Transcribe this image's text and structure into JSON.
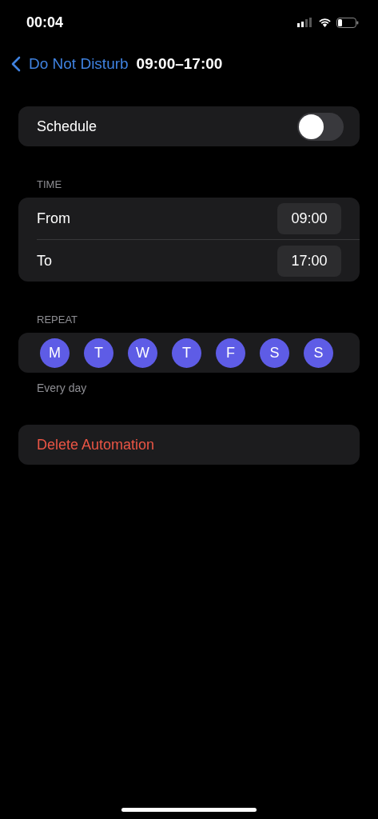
{
  "status_bar": {
    "time": "00:04"
  },
  "nav": {
    "back_label": "Do Not Disturb",
    "title": "09:00–17:00"
  },
  "schedule": {
    "label": "Schedule",
    "on": false
  },
  "time": {
    "header": "TIME",
    "rows": [
      {
        "label": "From",
        "value": "09:00"
      },
      {
        "label": "To",
        "value": "17:00"
      }
    ]
  },
  "repeat": {
    "header": "REPEAT",
    "days": [
      {
        "label": "M",
        "selected": true
      },
      {
        "label": "T",
        "selected": true
      },
      {
        "label": "W",
        "selected": true
      },
      {
        "label": "T",
        "selected": true
      },
      {
        "label": "F",
        "selected": true
      },
      {
        "label": "S",
        "selected": true
      },
      {
        "label": "S",
        "selected": true
      }
    ],
    "footer": "Every day"
  },
  "delete_button": "Delete Automation"
}
